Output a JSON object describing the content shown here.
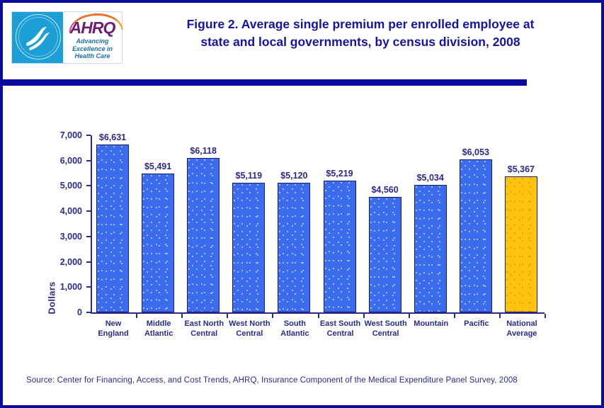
{
  "header": {
    "title_line1": "Figure 2. Average single premium per enrolled employee at",
    "title_line2": "state and local governments, by census division, 2008",
    "logo": {
      "seal_icon": "hhs-seal-icon",
      "wordmark": "AHRQ",
      "tagline_line1": "Advancing",
      "tagline_line2": "Excellence in",
      "tagline_line3": "Health Care"
    }
  },
  "source": {
    "text": "Source: Center for Financing, Access, and Cost Trends, AHRQ, Insurance Component of the Medical Expenditure Panel Survey, 2008"
  },
  "colors": {
    "frame": "#0b0b9e",
    "title": "#1414a0",
    "axis": "#2a2a8c",
    "bar_blue": "#3b6cee",
    "bar_gold": "#ffc20e",
    "bar_outline": "#1d1d7a"
  },
  "chart_data": {
    "type": "bar",
    "title": "Figure 2. Average single premium per enrolled employee at state and local governments, by census division, 2008",
    "xlabel": "",
    "ylabel": "Dollars",
    "ylim": [
      0,
      7000
    ],
    "ytick_labels": [
      "0",
      "1,000",
      "2,000",
      "3,000",
      "4,000",
      "5,000",
      "6,000",
      "7,000"
    ],
    "ytick_values": [
      0,
      1000,
      2000,
      3000,
      4000,
      5000,
      6000,
      7000
    ],
    "grid": false,
    "legend": "none",
    "categories": [
      "New England",
      "Middle Atlantic",
      "East North Central",
      "West North Central",
      "South Atlantic",
      "East South Central",
      "West South Central",
      "Mountain",
      "Pacific",
      "National Average"
    ],
    "category_lines": [
      [
        "New",
        "England"
      ],
      [
        "Middle",
        "Atlantic"
      ],
      [
        "East North",
        "Central"
      ],
      [
        "West North",
        "Central"
      ],
      [
        "South",
        "Atlantic"
      ],
      [
        "East South",
        "Central"
      ],
      [
        "West South",
        "Central"
      ],
      [
        "Mountain",
        ""
      ],
      [
        "Pacific",
        ""
      ],
      [
        "National",
        "Average"
      ]
    ],
    "values": [
      6631,
      5491,
      6118,
      5119,
      5120,
      5219,
      4560,
      5034,
      6053,
      5367
    ],
    "data_labels": [
      "$6,631",
      "$5,491",
      "$6,118",
      "$5,119",
      "$5,120",
      "$5,219",
      "$4,560",
      "$5,034",
      "$6,053",
      "$5,367"
    ],
    "bar_colors": [
      "#3b6cee",
      "#3b6cee",
      "#3b6cee",
      "#3b6cee",
      "#3b6cee",
      "#3b6cee",
      "#3b6cee",
      "#3b6cee",
      "#3b6cee",
      "#ffc20e"
    ]
  }
}
